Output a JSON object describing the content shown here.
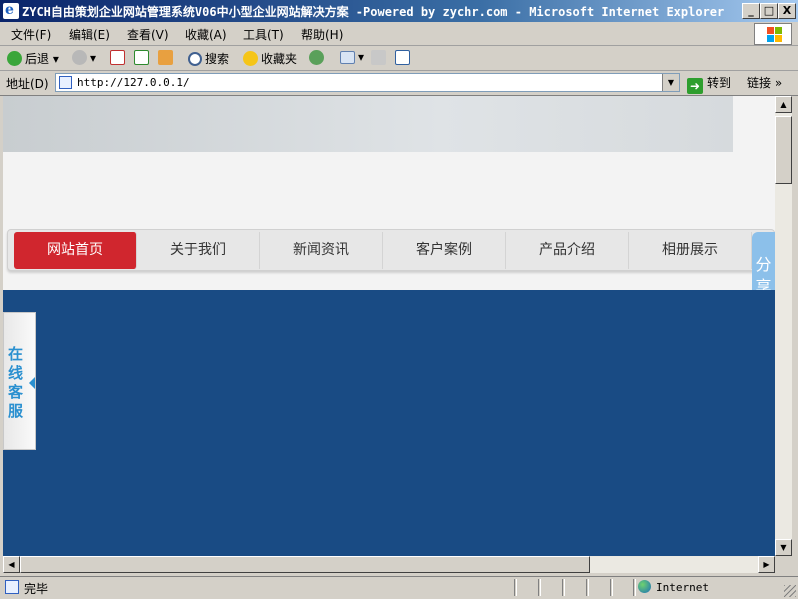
{
  "window": {
    "title": "ZYCH自由策划企业网站管理系统V06中小型企业网站解决方案 -Powered by zychr.com - Microsoft Internet Explorer",
    "controls": {
      "minimize": "_",
      "maximize": "□",
      "close": "X"
    }
  },
  "menubar": {
    "items": [
      "文件(F)",
      "编辑(E)",
      "查看(V)",
      "收藏(A)",
      "工具(T)",
      "帮助(H)"
    ]
  },
  "toolbar": {
    "back_label": "后退",
    "search_label": "搜索",
    "favorites_label": "收藏夹"
  },
  "address": {
    "label": "地址(D)",
    "url": "http://127.0.0.1/",
    "go_label": "转到",
    "links_label": "链接 »"
  },
  "page": {
    "nav": [
      "网站首页",
      "关于我们",
      "新闻资讯",
      "客户案例",
      "产品介绍",
      "相册展示"
    ],
    "active_nav": "网站首页",
    "share_label": "分享",
    "online_service_label": "在线客服"
  },
  "status": {
    "text": "完毕",
    "zone": "Internet"
  },
  "colors": {
    "nav_active": "#d0262e",
    "banner": "#194b84",
    "share_tab": "#8cc0ea",
    "service_text": "#2a90d0"
  }
}
